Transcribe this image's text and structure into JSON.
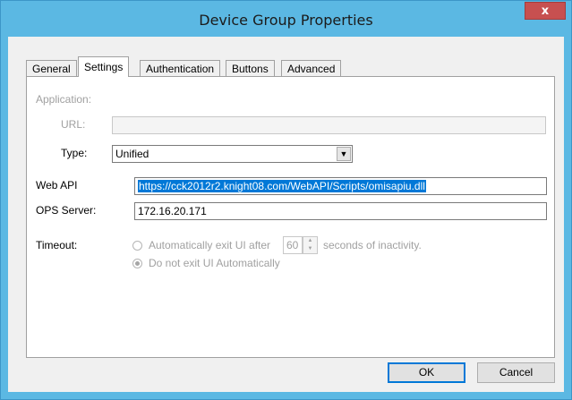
{
  "window": {
    "title": "Device Group Properties",
    "close_label": "x"
  },
  "tabs": [
    {
      "label": "General"
    },
    {
      "label": "Settings"
    },
    {
      "label": "Authentication"
    },
    {
      "label": "Buttons"
    },
    {
      "label": "Advanced"
    }
  ],
  "active_tab": "Settings",
  "application": {
    "section_label": "Application:",
    "url_label": "URL:",
    "url_value": "",
    "type_label": "Type:",
    "type_value": "Unified"
  },
  "web_api": {
    "label": "Web API",
    "value": "https://cck2012r2.knight08.com/WebAPI/Scripts/omisapiu.dll"
  },
  "ops_server": {
    "label": "OPS Server:",
    "value": "172.16.20.171"
  },
  "timeout": {
    "label": "Timeout:",
    "auto_exit_label": "Automatically exit UI after",
    "seconds_value": "60",
    "seconds_suffix": "seconds of inactivity.",
    "no_exit_label": "Do not exit UI Automatically",
    "selected": "no_exit"
  },
  "buttons": {
    "ok": "OK",
    "cancel": "Cancel"
  }
}
